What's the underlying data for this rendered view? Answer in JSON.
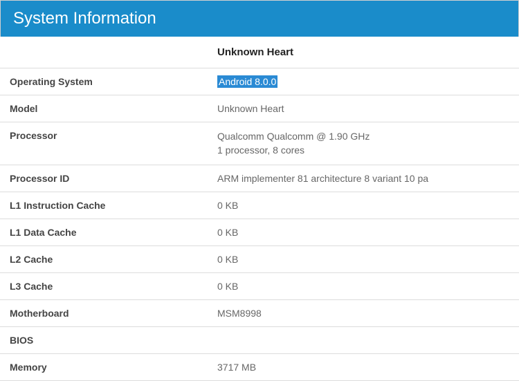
{
  "header": {
    "title": "System Information"
  },
  "table": {
    "device_name": "Unknown Heart",
    "rows": [
      {
        "label": "Operating System",
        "value": "Android 8.0.0",
        "highlighted": true
      },
      {
        "label": "Model",
        "value": "Unknown Heart"
      },
      {
        "label": "Processor",
        "value": "Qualcomm Qualcomm @ 1.90 GHz\n1 processor, 8 cores"
      },
      {
        "label": "Processor ID",
        "value": "ARM implementer 81 architecture 8 variant 10 pa"
      },
      {
        "label": "L1 Instruction Cache",
        "value": "0 KB"
      },
      {
        "label": "L1 Data Cache",
        "value": "0 KB"
      },
      {
        "label": "L2 Cache",
        "value": "0 KB"
      },
      {
        "label": "L3 Cache",
        "value": "0 KB"
      },
      {
        "label": "Motherboard",
        "value": "MSM8998"
      },
      {
        "label": "BIOS",
        "value": ""
      },
      {
        "label": "Memory",
        "value": "3717 MB"
      }
    ]
  }
}
